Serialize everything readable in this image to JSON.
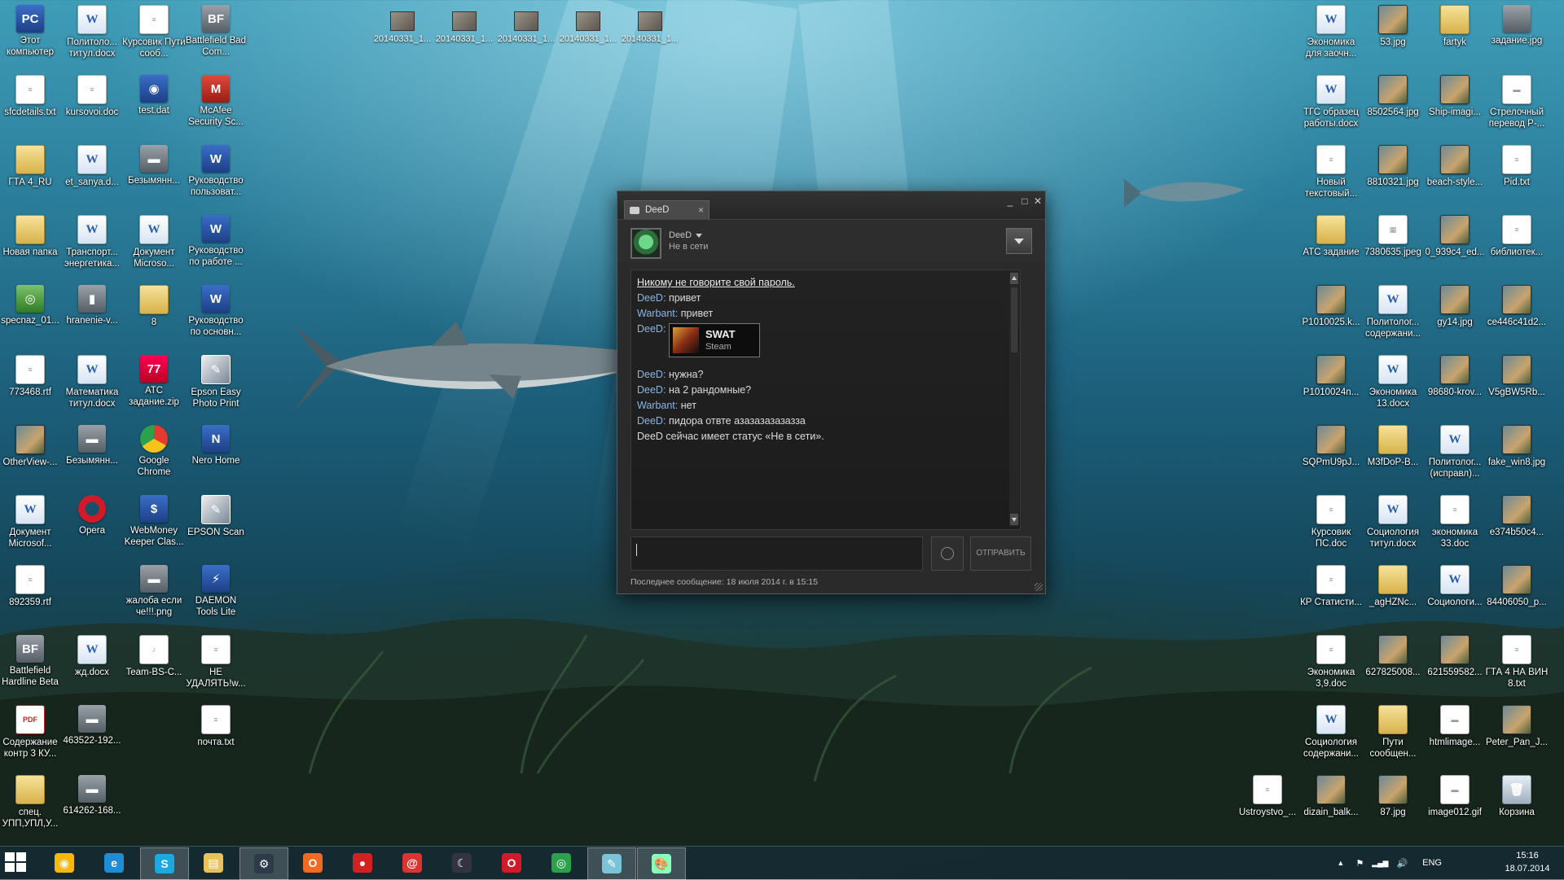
{
  "desktop": {
    "top_thumbnails": [
      "20140331_1...",
      "20140331_1...",
      "20140331_1...",
      "20140331_1...",
      "20140331_1..."
    ],
    "left_icons": [
      {
        "label": "Этот компьютер",
        "type": "app",
        "glyph": "PC"
      },
      {
        "label": "Политоло... титул.docx",
        "type": "word",
        "glyph": "W"
      },
      {
        "label": "Курсовик Пути сооб...",
        "type": "txt",
        "glyph": "≡"
      },
      {
        "label": "Battlefield Bad Com...",
        "type": "gray",
        "glyph": "BF"
      },
      {
        "label": "sfcdetails.txt",
        "type": "txt",
        "glyph": "≡"
      },
      {
        "label": "kursovoi.doc",
        "type": "txt",
        "glyph": "≡"
      },
      {
        "label": "test.dat",
        "type": "app",
        "glyph": "◉"
      },
      {
        "label": "McAfee Security Sc...",
        "type": "red",
        "glyph": "M"
      },
      {
        "label": "ГТА 4_RU",
        "type": "folder",
        "glyph": ""
      },
      {
        "label": "et_sanya.d...",
        "type": "word",
        "glyph": "W"
      },
      {
        "label": "Безымянн...",
        "type": "gray",
        "glyph": "▬"
      },
      {
        "label": "Руководство пользоват...",
        "type": "app",
        "glyph": "W"
      },
      {
        "label": "Новая папка",
        "type": "folder",
        "glyph": ""
      },
      {
        "label": "Транспорт... энергетика...",
        "type": "word",
        "glyph": "W"
      },
      {
        "label": "Документ Microso...",
        "type": "word",
        "glyph": "W"
      },
      {
        "label": "Руководство по работе ...",
        "type": "app",
        "glyph": "W"
      },
      {
        "label": "specnaz_01...",
        "type": "green",
        "glyph": "◎"
      },
      {
        "label": "hranenie-v...",
        "type": "gray",
        "glyph": "▮"
      },
      {
        "label": "8",
        "type": "folder",
        "glyph": ""
      },
      {
        "label": "Руководство по основн...",
        "type": "app",
        "glyph": "W"
      },
      {
        "label": "773468.rtf",
        "type": "txt",
        "glyph": "≡"
      },
      {
        "label": "Математика титул.docx",
        "type": "word",
        "glyph": "W"
      },
      {
        "label": "АТС задание.zip",
        "type": "zip",
        "glyph": "77"
      },
      {
        "label": "Epson Easy Photo Print",
        "type": "photo",
        "glyph": "✎"
      },
      {
        "label": "OtherView-...",
        "type": "img",
        "glyph": ""
      },
      {
        "label": "Безымянн...",
        "type": "gray",
        "glyph": "▬"
      },
      {
        "label": "Google Chrome",
        "type": "chrome",
        "glyph": ""
      },
      {
        "label": "Nero Home",
        "type": "app",
        "glyph": "N"
      },
      {
        "label": "Документ Microsof...",
        "type": "word",
        "glyph": "W"
      },
      {
        "label": "Opera",
        "type": "opera",
        "glyph": ""
      },
      {
        "label": "WebMoney Keeper Clas...",
        "type": "app",
        "glyph": "$"
      },
      {
        "label": "EPSON Scan",
        "type": "photo",
        "glyph": "✎"
      },
      {
        "label": "892359.rtf",
        "type": "txt",
        "glyph": "≡"
      },
      {
        "label": "",
        "type": "none",
        "glyph": ""
      },
      {
        "label": "жалоба если че!!!.png",
        "type": "gray",
        "glyph": "▬"
      },
      {
        "label": "DAEMON Tools Lite",
        "type": "app",
        "glyph": "⚡"
      },
      {
        "label": "Battlefield Hardline Beta",
        "type": "gray",
        "glyph": "BF"
      },
      {
        "label": "жд.docx",
        "type": "word",
        "glyph": "W"
      },
      {
        "label": "Team-BS-C...",
        "type": "txt",
        "glyph": "♪"
      },
      {
        "label": "НЕ УДАЛЯТЬ!w...",
        "type": "txt",
        "glyph": "≡"
      },
      {
        "label": "Содержание контр 3 КУ...",
        "type": "pdf",
        "glyph": "PDF"
      },
      {
        "label": "463522-192...",
        "type": "gray",
        "glyph": "▬"
      },
      {
        "label": "",
        "type": "none",
        "glyph": ""
      },
      {
        "label": "почта.txt",
        "type": "txt",
        "glyph": "≡"
      },
      {
        "label": "спец. УПП,УПЛ,У...",
        "type": "folder",
        "glyph": ""
      },
      {
        "label": "614262-168...",
        "type": "gray",
        "glyph": "▬"
      }
    ],
    "right_icons": [
      {
        "label": "Экономика для заочн...",
        "type": "word",
        "glyph": "W"
      },
      {
        "label": "53.jpg",
        "type": "img",
        "glyph": ""
      },
      {
        "label": "fartyk",
        "type": "folder",
        "glyph": ""
      },
      {
        "label": "задание.jpg",
        "type": "gray",
        "glyph": ""
      },
      {
        "label": "ТГС образец работы.docx",
        "type": "word",
        "glyph": "W"
      },
      {
        "label": "8502564.jpg",
        "type": "img",
        "glyph": ""
      },
      {
        "label": "Ship-imagi...",
        "type": "img",
        "glyph": ""
      },
      {
        "label": "Стрелочный перевод Р-...",
        "type": "txt",
        "glyph": "▬"
      },
      {
        "label": "Новый текстовый...",
        "type": "txt",
        "glyph": "≡"
      },
      {
        "label": "8810321.jpg",
        "type": "img",
        "glyph": ""
      },
      {
        "label": "beach-style...",
        "type": "img",
        "glyph": ""
      },
      {
        "label": "Pid.txt",
        "type": "txt",
        "glyph": "≡"
      },
      {
        "label": "АТС задание",
        "type": "folder",
        "glyph": ""
      },
      {
        "label": "7380635.jpeg",
        "type": "txt",
        "glyph": "▦"
      },
      {
        "label": "0_939c4_ed...",
        "type": "img",
        "glyph": ""
      },
      {
        "label": "библиотек...",
        "type": "txt",
        "glyph": "≡"
      },
      {
        "label": "P1010025.k...",
        "type": "img",
        "glyph": ""
      },
      {
        "label": "Политолог... содержани...",
        "type": "word",
        "glyph": "W"
      },
      {
        "label": "gy14.jpg",
        "type": "img",
        "glyph": ""
      },
      {
        "label": "ce446c41d2...",
        "type": "img",
        "glyph": ""
      },
      {
        "label": "P1010024n...",
        "type": "img",
        "glyph": ""
      },
      {
        "label": "Экономика 13.docx",
        "type": "word",
        "glyph": "W"
      },
      {
        "label": "98680-krov...",
        "type": "img",
        "glyph": ""
      },
      {
        "label": "V5gBW5Rb...",
        "type": "img",
        "glyph": ""
      },
      {
        "label": "SQPmU9pJ...",
        "type": "img",
        "glyph": ""
      },
      {
        "label": "M3fDoP-B...",
        "type": "folder",
        "glyph": ""
      },
      {
        "label": "Политолог... (исправл)...",
        "type": "word",
        "glyph": "W"
      },
      {
        "label": "fake_win8.jpg",
        "type": "img",
        "glyph": ""
      },
      {
        "label": "Курсовик ПС.doc",
        "type": "txt",
        "glyph": "≡"
      },
      {
        "label": "Социология титул.docx",
        "type": "word",
        "glyph": "W"
      },
      {
        "label": "экономика 33.doc",
        "type": "txt",
        "glyph": "≡"
      },
      {
        "label": "e374b50c4...",
        "type": "img",
        "glyph": ""
      },
      {
        "label": "КР Статисти...",
        "type": "txt",
        "glyph": "≡"
      },
      {
        "label": "_agHZNc...",
        "type": "folder",
        "glyph": ""
      },
      {
        "label": "Социологи...",
        "type": "word",
        "glyph": "W"
      },
      {
        "label": "84406050_p...",
        "type": "img",
        "glyph": ""
      },
      {
        "label": "Экономика 3,9.doc",
        "type": "txt",
        "glyph": "≡"
      },
      {
        "label": "627825008...",
        "type": "img",
        "glyph": ""
      },
      {
        "label": "621559582...",
        "type": "img",
        "glyph": ""
      },
      {
        "label": "ГТА 4 НА ВИН 8.txt",
        "type": "txt",
        "glyph": "≡"
      },
      {
        "label": "Социология содержани...",
        "type": "word",
        "glyph": "W"
      },
      {
        "label": "Пути сообщен...",
        "type": "folder",
        "glyph": ""
      },
      {
        "label": "htmlimage...",
        "type": "txt",
        "glyph": "▬"
      },
      {
        "label": "Peter_Pan_J...",
        "type": "img",
        "glyph": ""
      }
    ],
    "bottom_right_icons": [
      {
        "label": "Ustroystvo_...",
        "type": "txt",
        "glyph": "≡"
      },
      {
        "label": "dizain_balk...",
        "type": "img",
        "glyph": ""
      },
      {
        "label": "87.jpg",
        "type": "img",
        "glyph": ""
      },
      {
        "label": "image012.gif",
        "type": "txt",
        "glyph": "▬"
      },
      {
        "label": "Корзина",
        "type": "bin",
        "glyph": "🗑"
      }
    ]
  },
  "chat": {
    "tab_label": "DeeD",
    "tab_close": "×",
    "win_min": "_",
    "win_max": "□",
    "win_close": "✕",
    "friend_name": "DeeD",
    "friend_status": "Не в сети",
    "warning": "Никому не говорите свой пароль.",
    "messages": [
      {
        "who": "DeeD",
        "text": "привет"
      },
      {
        "who": "Warbant",
        "text": "привет"
      },
      {
        "who": "DeeD",
        "text": ""
      },
      {
        "who": "DeeD",
        "text": "нужна?"
      },
      {
        "who": "DeeD",
        "text": "на 2 рандомные?"
      },
      {
        "who": "Warbant",
        "text": "нет"
      },
      {
        "who": "DeeD",
        "text": "пидора отвте азазазазазазза"
      }
    ],
    "game_card": {
      "name": "SWAT",
      "sub": "Steam"
    },
    "system_notice": "DeeD сейчас имеет статус «Не в сети».",
    "send_label": "ОТПРАВИТЬ",
    "last_message": "Последнее сообщение: 18 июля 2014 г. в 15:15",
    "who_separator": ":"
  },
  "taskbar": {
    "apps": [
      {
        "name": "picasa",
        "glyph": "◉",
        "color": "#f6b80f",
        "active": false
      },
      {
        "name": "internet-explorer",
        "glyph": "e",
        "color": "#1f8dd6",
        "active": false
      },
      {
        "name": "skype",
        "glyph": "S",
        "color": "#1ba9e4",
        "active": true
      },
      {
        "name": "file-explorer",
        "glyph": "▤",
        "color": "#e8c35a",
        "active": false
      },
      {
        "name": "steam",
        "glyph": "⚙",
        "color": "#2c3a4a",
        "active": true
      },
      {
        "name": "origin",
        "glyph": "O",
        "color": "#f06a23",
        "active": false
      },
      {
        "name": "recorder",
        "glyph": "●",
        "color": "#d32020",
        "active": false
      },
      {
        "name": "mail-agent",
        "glyph": "@",
        "color": "#d33",
        "active": false
      },
      {
        "name": "moon-app",
        "glyph": "☾",
        "color": "#334",
        "active": false
      },
      {
        "name": "opera",
        "glyph": "O",
        "color": "#d11b2b",
        "active": false
      },
      {
        "name": "chrome",
        "glyph": "◎",
        "color": "#2ba14b",
        "active": false
      },
      {
        "name": "notes",
        "glyph": "✎",
        "color": "#7bc4d8",
        "active": true
      },
      {
        "name": "paint",
        "glyph": "🎨",
        "color": "#8fb",
        "active": true
      }
    ],
    "tray": {
      "lang": "ENG",
      "chevron": "▲",
      "flag": "⚑",
      "signal": "▂▄▆",
      "volume": "🔊"
    },
    "time": "15:16",
    "date": "18.07.2014"
  }
}
